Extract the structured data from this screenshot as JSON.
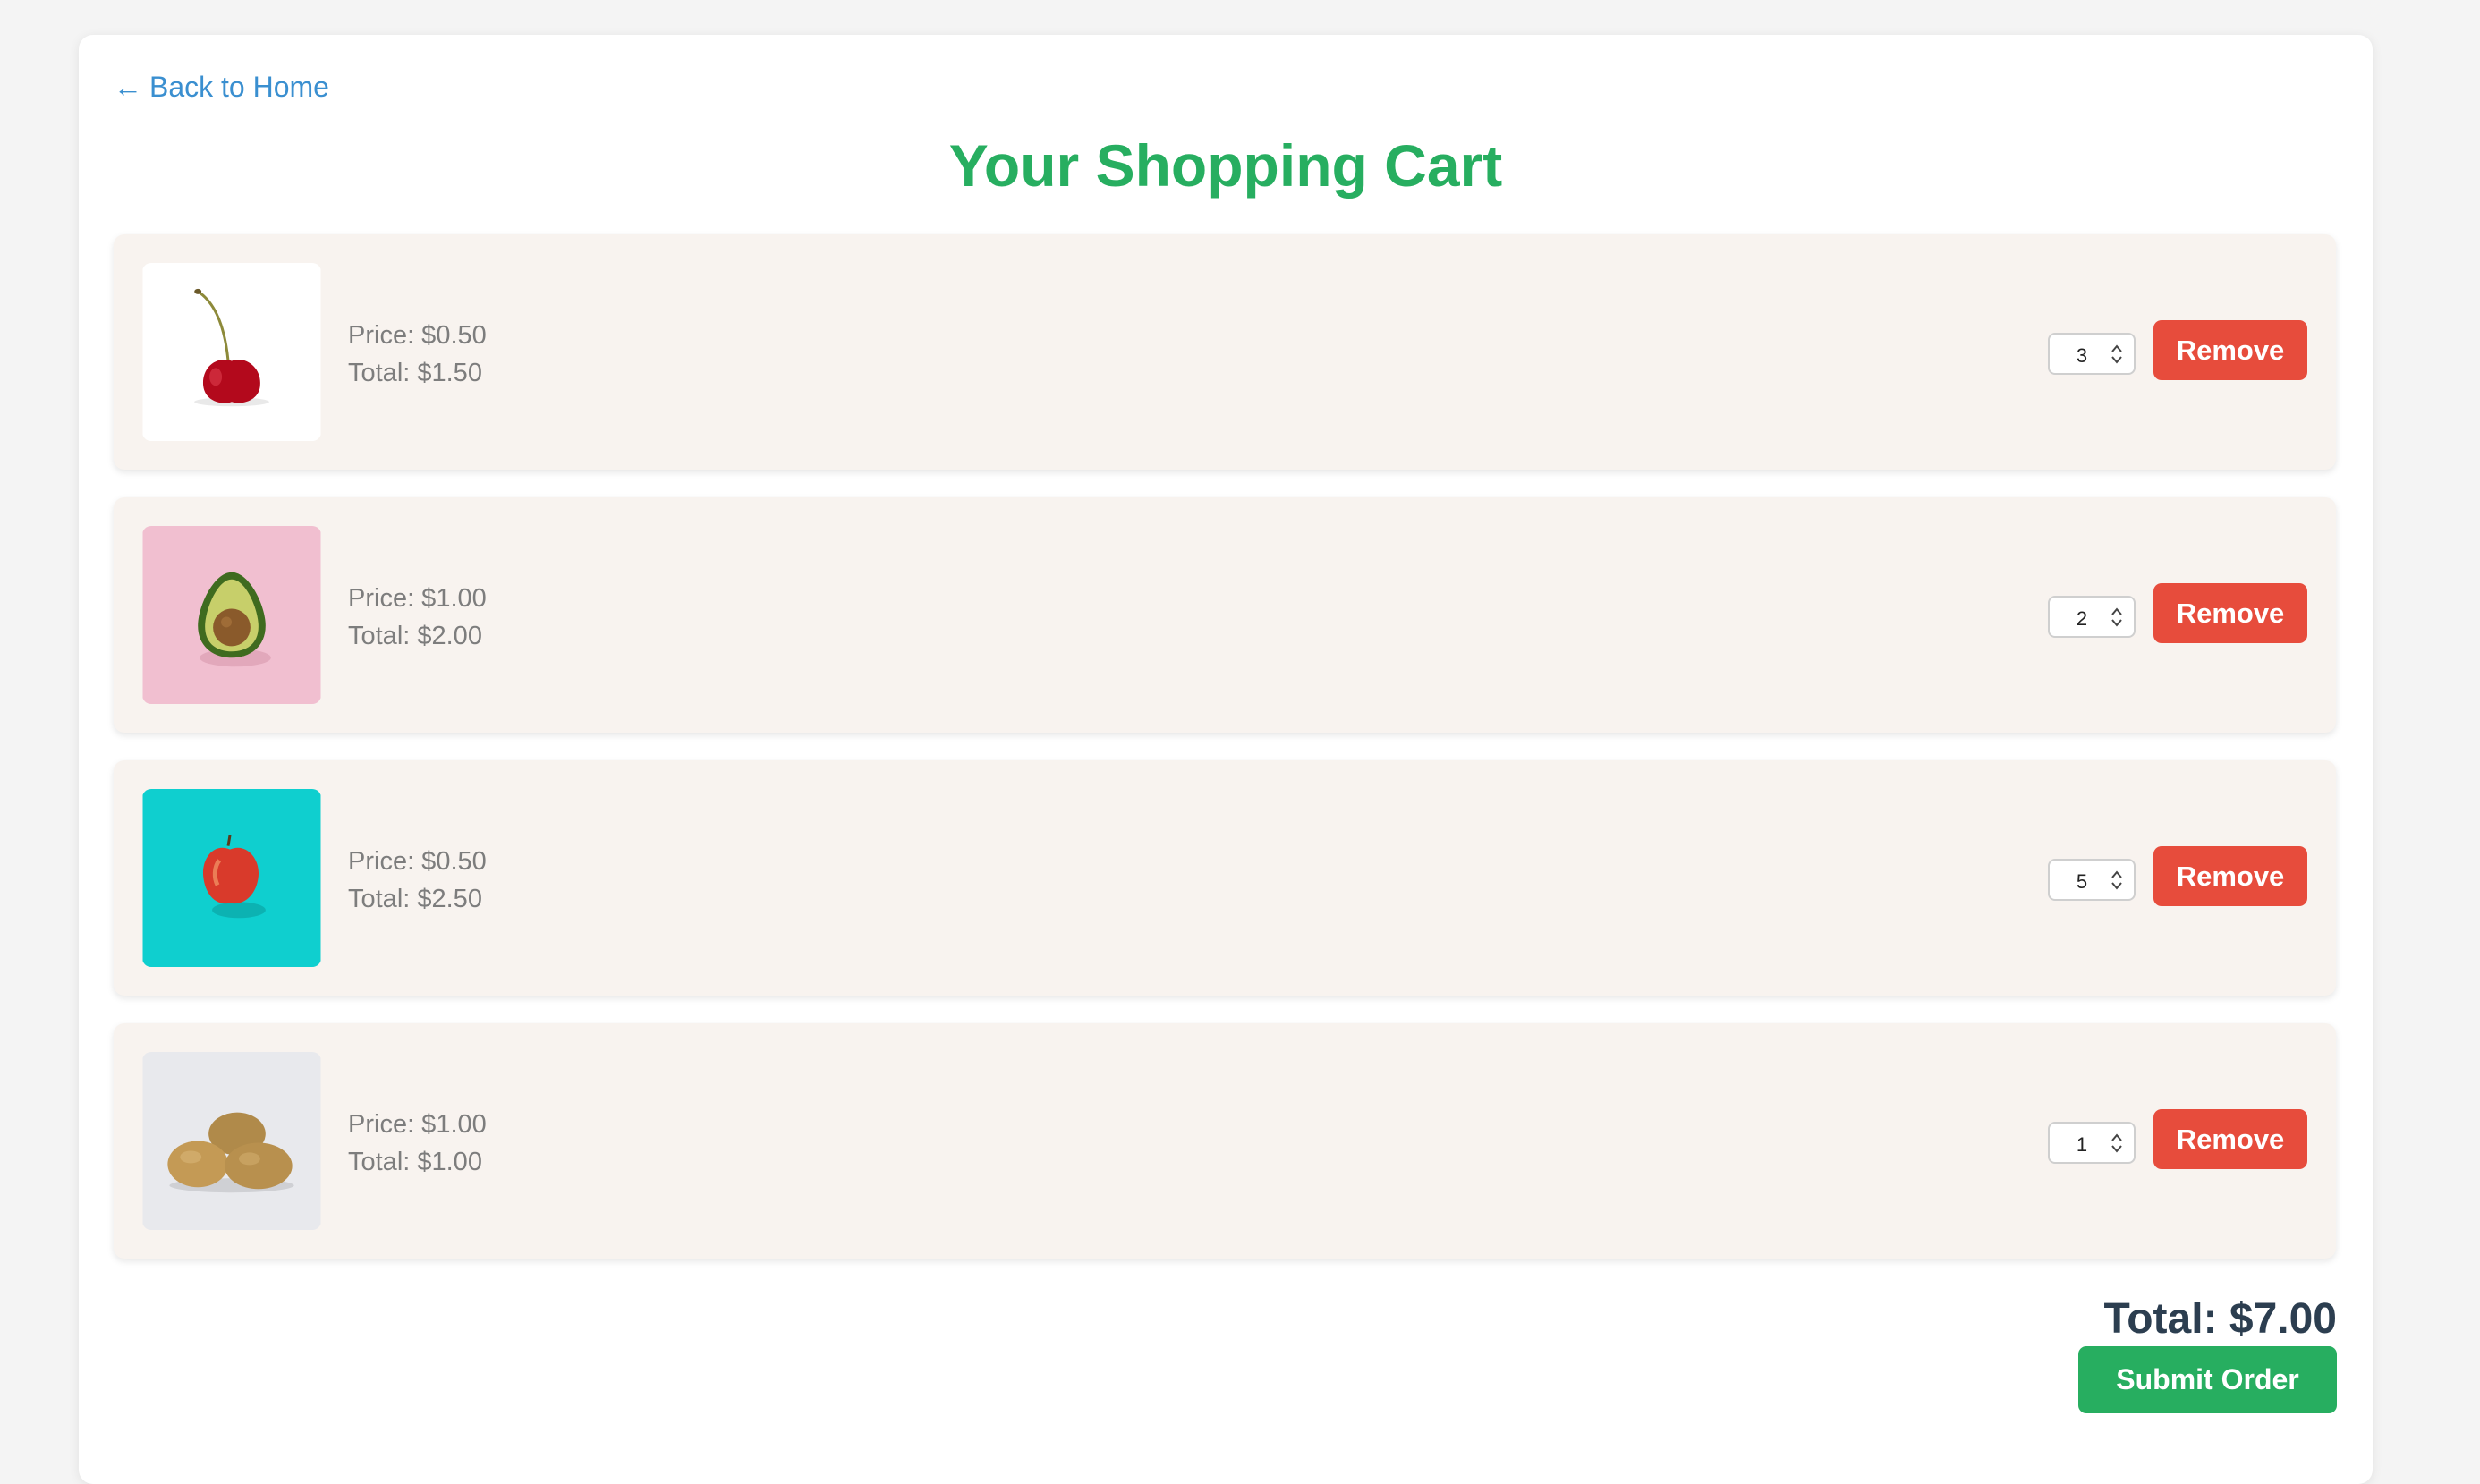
{
  "nav": {
    "back_arrow": "←",
    "back_label": "Back to Home"
  },
  "page_title": "Your Shopping Cart",
  "cart": {
    "items": [
      {
        "image": "cherry-image",
        "price": "Price: $0.50",
        "total": "Total: $1.50",
        "quantity": "3",
        "remove_label": "Remove"
      },
      {
        "image": "avocado-image",
        "price": "Price: $1.00",
        "total": "Total: $2.00",
        "quantity": "2",
        "remove_label": "Remove"
      },
      {
        "image": "apple-image",
        "price": "Price: $0.50",
        "total": "Total: $2.50",
        "quantity": "5",
        "remove_label": "Remove"
      },
      {
        "image": "kiwi-image",
        "price": "Price: $1.00",
        "total": "Total: $1.00",
        "quantity": "1",
        "remove_label": "Remove"
      }
    ],
    "total": "Total: $7.00",
    "submit_label": "Submit Order"
  },
  "colors": {
    "accent_green": "#27ae60",
    "link_blue": "#3a8fd0",
    "remove_red": "#e74c3c",
    "item_background": "#f8f3ef",
    "total_text": "#2c3e50"
  }
}
